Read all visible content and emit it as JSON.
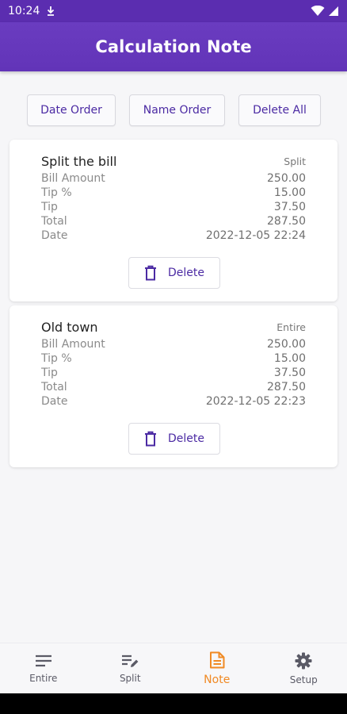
{
  "status_bar": {
    "time": "10:24"
  },
  "app_bar": {
    "title": "Calculation Note"
  },
  "toolbar": {
    "date_order": "Date Order",
    "name_order": "Name Order",
    "delete_all": "Delete All"
  },
  "notes": [
    {
      "title": "Split the bill",
      "type": "Split",
      "rows": [
        {
          "label": "Bill Amount",
          "value": "250.00"
        },
        {
          "label": "Tip %",
          "value": "15.00"
        },
        {
          "label": "Tip",
          "value": "37.50"
        },
        {
          "label": "Total",
          "value": "287.50"
        },
        {
          "label": "Date",
          "value": "2022-12-05 22:24"
        }
      ],
      "delete_label": "Delete"
    },
    {
      "title": "Old town",
      "type": "Entire",
      "rows": [
        {
          "label": "Bill Amount",
          "value": "250.00"
        },
        {
          "label": "Tip %",
          "value": "15.00"
        },
        {
          "label": "Tip",
          "value": "37.50"
        },
        {
          "label": "Total",
          "value": "287.50"
        },
        {
          "label": "Date",
          "value": "2022-12-05 22:23"
        }
      ],
      "delete_label": "Delete"
    }
  ],
  "bottom_nav": {
    "items": [
      {
        "label": "Entire",
        "icon": "list-icon"
      },
      {
        "label": "Split",
        "icon": "edit-list-icon"
      },
      {
        "label": "Note",
        "icon": "note-icon",
        "active": true
      },
      {
        "label": "Setup",
        "icon": "gear-icon"
      }
    ]
  },
  "colors": {
    "primary": "#6234b8",
    "accent": "#f08a24",
    "button_text": "#4b2aa3"
  }
}
